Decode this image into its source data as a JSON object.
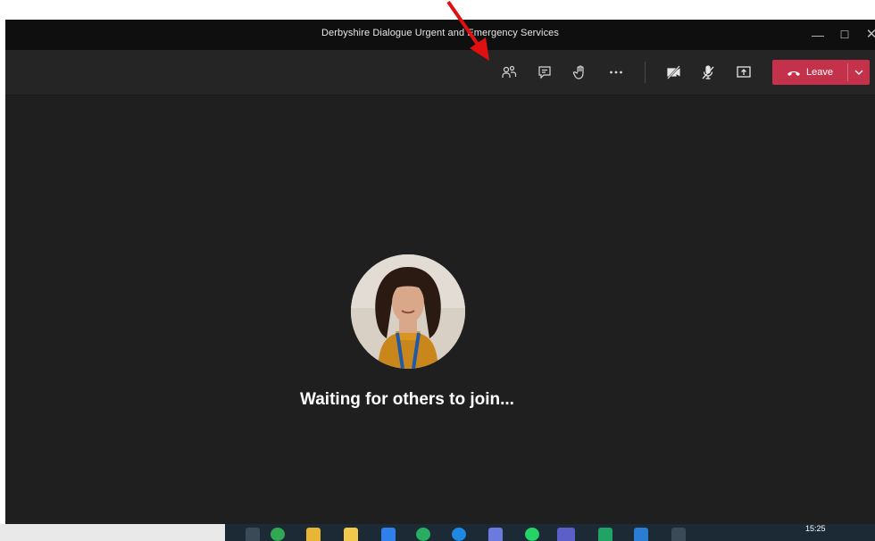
{
  "window": {
    "title": "Derbyshire Dialogue Urgent and Emergency Services",
    "controls": {
      "minimize": "—",
      "maximize": "☐",
      "close": "✕"
    }
  },
  "toolbar": {
    "buttons": [
      {
        "name": "participants",
        "icon": "people-icon"
      },
      {
        "name": "chat",
        "icon": "chat-icon"
      },
      {
        "name": "raise-hand",
        "icon": "hand-icon"
      },
      {
        "name": "more-options",
        "icon": "more-icon"
      },
      {
        "name": "camera-off",
        "icon": "camera-off-icon"
      },
      {
        "name": "mic-off",
        "icon": "mic-off-icon"
      },
      {
        "name": "share",
        "icon": "share-screen-icon"
      }
    ],
    "leave_label": "Leave",
    "leave_color": "#c4314b"
  },
  "stage": {
    "waiting_text": "Waiting for others to join..."
  },
  "taskbar": {
    "clock": "15:25"
  },
  "annotation": {
    "color": "#e01010"
  }
}
